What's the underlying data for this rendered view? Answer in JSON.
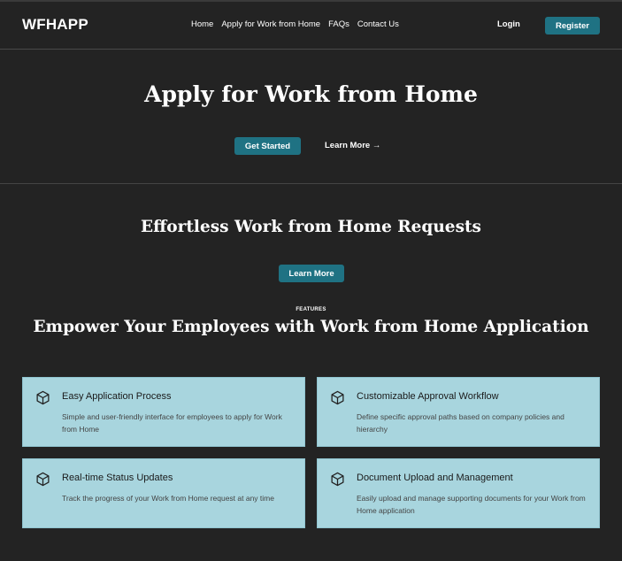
{
  "header": {
    "logo": "WFHAPP",
    "nav": [
      "Home",
      "Apply for Work from Home",
      "FAQs",
      "Contact Us"
    ],
    "login": "Login",
    "register": "Register"
  },
  "hero": {
    "title": "Apply for Work from Home",
    "get_started": "Get Started",
    "learn_more": "Learn More →"
  },
  "section": {
    "title": "Effortless Work from Home Requests",
    "learn_more": "Learn More"
  },
  "features": {
    "label": "FEATURES",
    "title": "Empower Your Employees with Work from Home Application",
    "cards": [
      {
        "icon": "cube-icon",
        "title": "Easy Application Process",
        "desc": "Simple and user-friendly interface for employees to apply for Work from Home"
      },
      {
        "icon": "cube-icon",
        "title": "Customizable Approval Workflow",
        "desc": "Define specific approval paths based on company policies and hierarchy"
      },
      {
        "icon": "cube-icon",
        "title": "Real-time Status Updates",
        "desc": "Track the progress of your Work from Home request at any time"
      },
      {
        "icon": "cube-icon",
        "title": "Document Upload and Management",
        "desc": "Easily upload and manage supporting documents for your Work from Home application"
      }
    ]
  },
  "colors": {
    "background": "#232323",
    "accent": "#1f7283",
    "card": "#a8d5de"
  }
}
